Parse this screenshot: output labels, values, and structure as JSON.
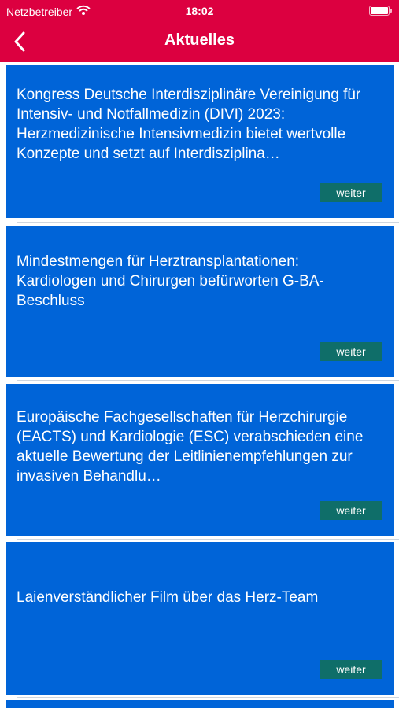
{
  "status_bar": {
    "carrier": "Netzbetreiber",
    "time": "18:02"
  },
  "nav": {
    "title": "Aktuelles"
  },
  "colors": {
    "header": "#dc0040",
    "card": "#0064d8",
    "button": "#0f6e69"
  },
  "news": [
    {
      "text": "Kongress Deutsche Interdisziplinäre Vereinigung für Intensiv- und Notfallmedizin (DIVI) 2023: Herzmedizinische Intensivmedizin bietet wertvolle Konzepte und setzt auf Interdisziplina…",
      "button": "weiter"
    },
    {
      "text": "Mindestmengen für Herztransplantationen: Kardiologen und Chirurgen befürworten G-BA-Beschluss",
      "button": "weiter"
    },
    {
      "text": "Europäische Fachgesellschaften für Herzchirurgie (EACTS) und Kardiologie (ESC) verabschieden eine aktuelle Bewertung der Leitlinienempfehlungen zur invasiven Behandlu…",
      "button": "weiter"
    },
    {
      "text": "Laienverständlicher Film über das Herz-Team",
      "button": "weiter"
    }
  ]
}
